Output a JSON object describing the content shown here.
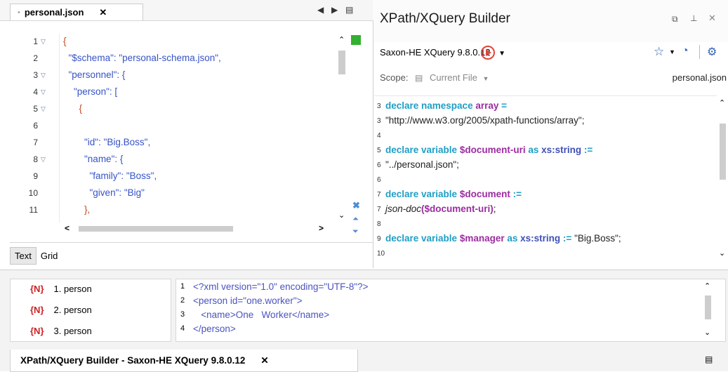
{
  "editor": {
    "tab": {
      "title": "personal.json",
      "close": "✕",
      "dot": "•"
    },
    "nav": {
      "left": "◀",
      "right": "▶",
      "menu": "▤"
    },
    "line_numbers": [
      "1",
      "2",
      "3",
      "4",
      "5",
      "6",
      "7",
      "8",
      "9",
      "10",
      "11"
    ],
    "lines": [
      "{",
      "  \"$schema\": \"personal-schema.json\",",
      "  \"personnel\": {",
      "    \"person\": [",
      "      {",
      "",
      "        \"id\": \"Big.Boss\",",
      "        \"name\": {",
      "          \"family\": \"Boss\",",
      "          \"given\": \"Big\"",
      "        },"
    ],
    "mode_tabs": [
      "Text",
      "Grid"
    ]
  },
  "xpath": {
    "title": "XPath/XQuery Builder",
    "engine": "Saxon-HE XQuery 9.8.0.12",
    "scope_label": "Scope:",
    "scope_value": "Current File",
    "scope_file": "personal.json",
    "line_numbers": [
      "3",
      "3",
      "4",
      "5",
      "6",
      "6",
      "7",
      "7",
      "8",
      "9",
      "10"
    ],
    "code": [
      {
        "parts": [
          [
            "declare namespace ",
            "kw"
          ],
          [
            "array",
            "vr"
          ],
          [
            " =",
            "kw"
          ]
        ]
      },
      {
        "parts": [
          [
            "\"http://www.w3.org/2005/xpath-functions/array\";",
            "st"
          ]
        ]
      },
      {
        "parts": [
          [
            "",
            "st"
          ]
        ]
      },
      {
        "parts": [
          [
            "declare variable ",
            "kw"
          ],
          [
            "$document-uri",
            "vr"
          ],
          [
            " as ",
            "kw"
          ],
          [
            "xs:string",
            "ty"
          ],
          [
            " :=",
            "kw"
          ]
        ]
      },
      {
        "parts": [
          [
            "\"../personal.json\";",
            "st"
          ]
        ]
      },
      {
        "parts": [
          [
            "",
            "st"
          ]
        ]
      },
      {
        "parts": [
          [
            "declare variable ",
            "kw"
          ],
          [
            "$document",
            "vr"
          ],
          [
            " :=",
            "kw"
          ]
        ]
      },
      {
        "parts": [
          [
            "json-doc",
            "st"
          ],
          [
            "($document-uri)",
            "vr"
          ],
          [
            ";",
            "st"
          ]
        ]
      },
      {
        "parts": [
          [
            "",
            "st"
          ]
        ]
      },
      {
        "parts": [
          [
            "declare variable ",
            "kw"
          ],
          [
            "$manager",
            "vr"
          ],
          [
            " as ",
            "kw"
          ],
          [
            "xs:string",
            "ty"
          ],
          [
            " := ",
            "kw"
          ],
          [
            "\"Big.Boss\";",
            "st"
          ]
        ]
      },
      {
        "parts": [
          [
            "",
            "st"
          ]
        ]
      }
    ]
  },
  "results": {
    "items": [
      {
        "badge": "{N}",
        "label": "1. person"
      },
      {
        "badge": "{N}",
        "label": "2. person"
      },
      {
        "badge": "{N}",
        "label": "3. person"
      }
    ],
    "view_line_numbers": [
      "1",
      "2",
      "3",
      "4"
    ],
    "view_lines": [
      "<?xml version=\"1.0\" encoding=\"UTF-8\"?>",
      "<person id=\"one.worker\">",
      "   <name>One   Worker</name>",
      "</person>"
    ],
    "tab_title": "XPath/XQuery Builder - Saxon-HE XQuery 9.8.0.12",
    "tab_close": "✕"
  }
}
